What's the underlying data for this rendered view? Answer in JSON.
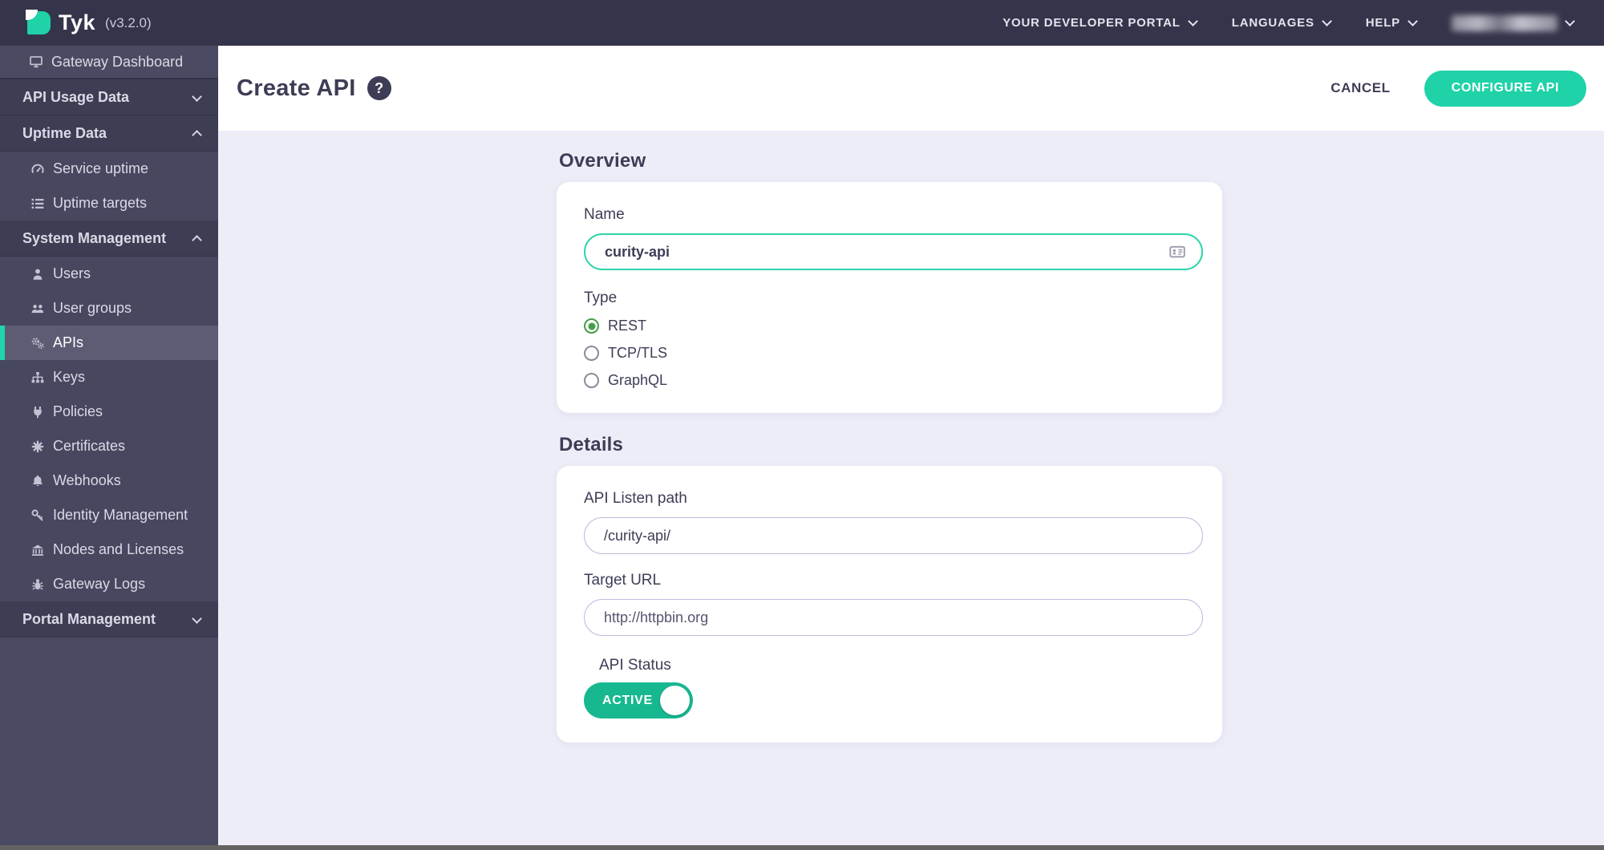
{
  "topbar": {
    "logo": "Tyk",
    "version": "(v3.2.0)",
    "developer_portal": "YOUR DEVELOPER PORTAL",
    "languages": "LANGUAGES",
    "help": "HELP"
  },
  "sidebar": {
    "gateway_dashboard": "Gateway Dashboard",
    "api_usage_data": "API Usage Data",
    "uptime_data": "Uptime Data",
    "service_uptime": "Service uptime",
    "uptime_targets": "Uptime targets",
    "system_management": "System Management",
    "users": "Users",
    "user_groups": "User groups",
    "apis": "APIs",
    "keys": "Keys",
    "policies": "Policies",
    "certificates": "Certificates",
    "webhooks": "Webhooks",
    "identity_management": "Identity Management",
    "nodes_and_licenses": "Nodes and Licenses",
    "gateway_logs": "Gateway Logs",
    "portal_management": "Portal Management"
  },
  "header": {
    "title": "Create API",
    "help_glyph": "?",
    "cancel": "CANCEL",
    "configure": "CONFIGURE API"
  },
  "overview": {
    "heading": "Overview",
    "name_label": "Name",
    "name_value": "curity-api",
    "type_label": "Type",
    "type_options": [
      {
        "label": "REST",
        "selected": true
      },
      {
        "label": "TCP/TLS",
        "selected": false
      },
      {
        "label": "GraphQL",
        "selected": false
      }
    ]
  },
  "details": {
    "heading": "Details",
    "listen_path_label": "API Listen path",
    "listen_path_value": "/curity-api/",
    "target_url_label": "Target URL",
    "target_url_value": "http://httpbin.org",
    "api_status_label": "API Status",
    "api_status_value": "ACTIVE"
  },
  "colors": {
    "accent_teal": "#20D2A8",
    "toggle_green": "#17B890",
    "radio_green": "#43A047",
    "topbar_bg": "#34344A",
    "sidebar_section_bg": "#3D3D54",
    "content_bg": "#EDEDF8"
  }
}
